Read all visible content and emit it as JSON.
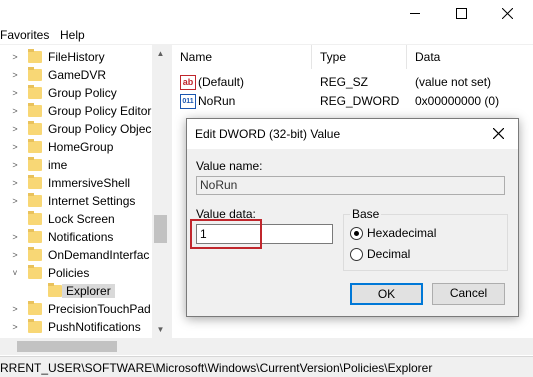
{
  "menubar": {
    "favorites": "Favorites",
    "help": "Help"
  },
  "window_controls": {
    "minimize_icon": "minimize-icon",
    "maximize_icon": "maximize-icon",
    "close_icon": "close-icon"
  },
  "tree": {
    "items": [
      {
        "label": "FileHistory",
        "expander": ">"
      },
      {
        "label": "GameDVR",
        "expander": ">"
      },
      {
        "label": "Group Policy",
        "expander": ">"
      },
      {
        "label": "Group Policy Editor",
        "expander": ">"
      },
      {
        "label": "Group Policy Objec",
        "expander": ">"
      },
      {
        "label": "HomeGroup",
        "expander": ">"
      },
      {
        "label": "ime",
        "expander": ">"
      },
      {
        "label": "ImmersiveShell",
        "expander": ">"
      },
      {
        "label": "Internet Settings",
        "expander": ">"
      },
      {
        "label": "Lock Screen",
        "expander": ""
      },
      {
        "label": "Notifications",
        "expander": ">"
      },
      {
        "label": "OnDemandInterfac",
        "expander": ">"
      },
      {
        "label": "Policies",
        "expander": "v"
      },
      {
        "label": "Explorer",
        "expander": ""
      },
      {
        "label": "PrecisionTouchPad",
        "expander": ">"
      },
      {
        "label": "PushNotifications",
        "expander": ">"
      }
    ]
  },
  "list": {
    "headers": {
      "name": "Name",
      "type": "Type",
      "data": "Data"
    },
    "rows": [
      {
        "icon": "ab",
        "name": "(Default)",
        "type": "REG_SZ",
        "data": "(value not set)"
      },
      {
        "icon": "011",
        "name": "NoRun",
        "type": "REG_DWORD",
        "data": "0x00000000 (0)"
      }
    ]
  },
  "status": {
    "path": "RRENT_USER\\SOFTWARE\\Microsoft\\Windows\\CurrentVersion\\Policies\\Explorer"
  },
  "dialog": {
    "title": "Edit DWORD (32-bit) Value",
    "value_name_label": "Value name:",
    "value_name": "NoRun",
    "value_data_label": "Value data:",
    "value_data": "1",
    "base_label": "Base",
    "hex_label": "Hexadecimal",
    "dec_label": "Decimal",
    "base_selected": "Hexadecimal",
    "ok": "OK",
    "cancel": "Cancel"
  },
  "colors": {
    "highlight": "#c0262c",
    "accent": "#0078d7",
    "folder": "#f8d775"
  }
}
